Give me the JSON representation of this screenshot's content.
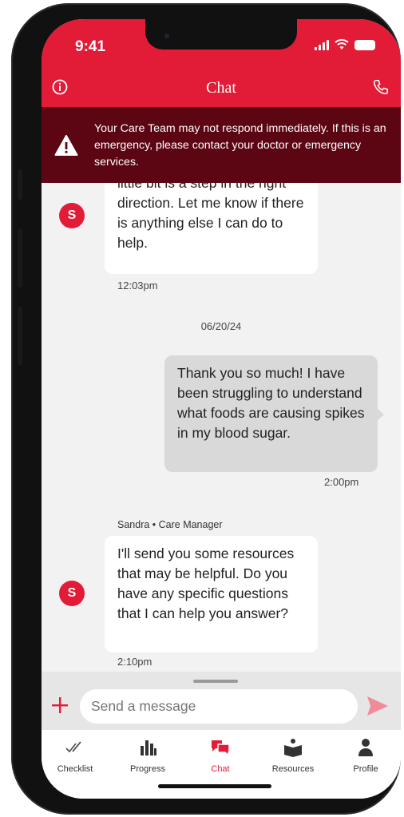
{
  "status_bar": {
    "time": "9:41"
  },
  "header": {
    "title": "Chat"
  },
  "banner": {
    "text": "Your Care Team may not respond immediately. If this is an emergency, please contact your doctor or emergency services."
  },
  "messages": [
    {
      "avatar": "S",
      "text": "little bit is a step in the right direction. Let me know if there is anything else I can do to help.",
      "time": "12:03pm"
    },
    {
      "date": "06/20/24"
    },
    {
      "text": "Thank you so much! I have been struggling to understand what foods are causing spikes in my blood sugar.",
      "time": "2:00pm"
    },
    {
      "sender": "Sandra • Care Manager",
      "avatar": "S",
      "text": "I'll send you some resources that may be helpful. Do you have any specific questions that I can help you answer?",
      "time": "2:10pm"
    }
  ],
  "composer": {
    "placeholder": "Send a message"
  },
  "tabs": [
    {
      "label": "Checklist",
      "icon": "double-check-icon"
    },
    {
      "label": "Progress",
      "icon": "bar-chart-icon"
    },
    {
      "label": "Chat",
      "icon": "chat-bubbles-icon",
      "active": true
    },
    {
      "label": "Resources",
      "icon": "book-person-icon"
    },
    {
      "label": "Profile",
      "icon": "person-icon"
    }
  ],
  "colors": {
    "brand_red": "#e21b37",
    "banner_bg": "#5c0613",
    "outgoing_bubble": "#d9d9d9"
  }
}
